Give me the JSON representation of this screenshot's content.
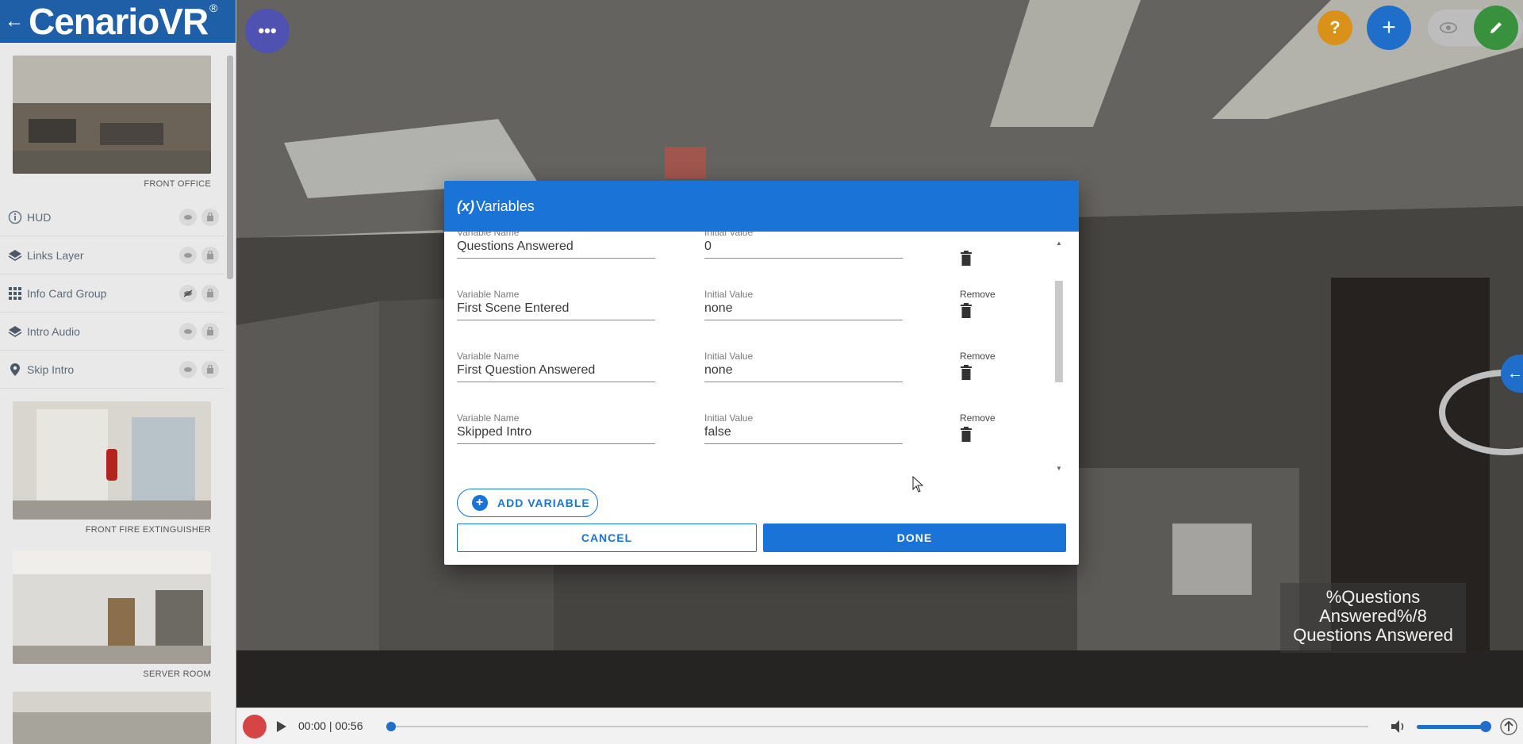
{
  "brand": {
    "name": "CenarioVR",
    "mark": "®"
  },
  "scenes": [
    {
      "label": "FRONT OFFICE"
    },
    {
      "label": "FRONT FIRE EXTINGUISHER"
    },
    {
      "label": "SERVER ROOM"
    }
  ],
  "layers": [
    {
      "label": "HUD",
      "icon": "info-icon"
    },
    {
      "label": "Links Layer",
      "icon": "layers-icon"
    },
    {
      "label": "Info Card Group",
      "icon": "grid-icon"
    },
    {
      "label": "Intro Audio",
      "icon": "layers-icon"
    },
    {
      "label": "Skip Intro",
      "icon": "pin-icon"
    }
  ],
  "menu_fab": "•••",
  "help_fab": "?",
  "add_fab": "+",
  "hud_text": "%Questions Answered%/8 Questions Answered",
  "player": {
    "time": "00:00 | 00:56"
  },
  "modal": {
    "title_prefix": "(x)",
    "title": "Variables",
    "name_label": "Variable Name",
    "value_label": "Initial Value",
    "remove_label": "Remove",
    "rows": [
      {
        "name": "Questions Answered",
        "value": "0"
      },
      {
        "name": "First Scene Entered",
        "value": "none"
      },
      {
        "name": "First Question Answered",
        "value": "none"
      },
      {
        "name": "Skipped Intro",
        "value": "false"
      }
    ],
    "add_label": "ADD VARIABLE",
    "cancel_label": "CANCEL",
    "done_label": "DONE"
  },
  "colors": {
    "brand": "#1f5fa8",
    "primary": "#1a73d6",
    "help": "#d9911a",
    "edit": "#38923d",
    "menu": "#4f52b0"
  }
}
